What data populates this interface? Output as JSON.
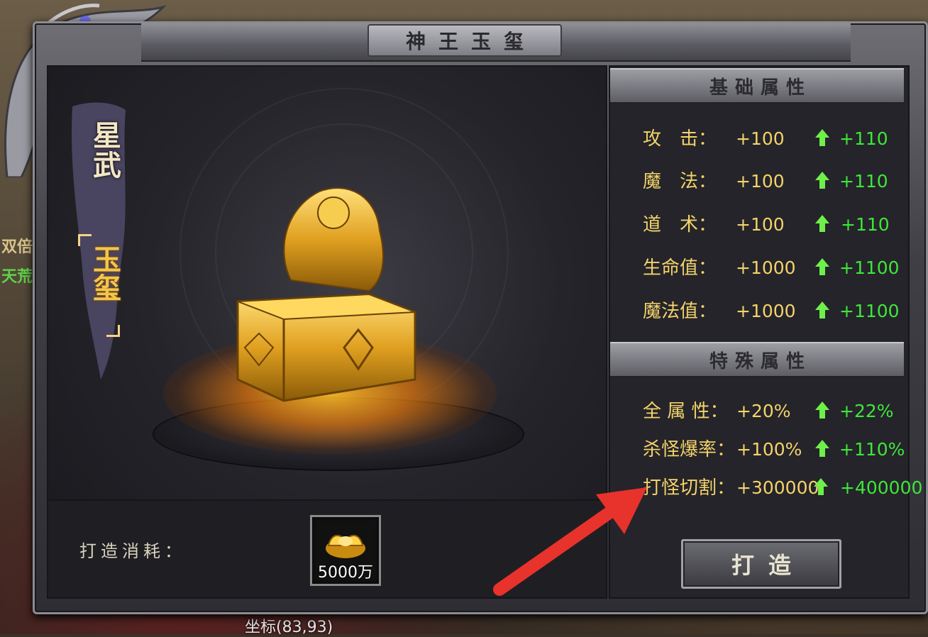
{
  "window": {
    "title": "神王玉玺"
  },
  "item": {
    "banner_line1": "星武",
    "banner_line2": "玉玺"
  },
  "cost": {
    "label": "打造消耗：",
    "amount": "5000万",
    "icon": "gold-ingot-icon"
  },
  "basic_attrs": {
    "title": "基础属性",
    "rows": [
      {
        "name": "攻　击：",
        "base": "+100",
        "new": "+110"
      },
      {
        "name": "魔　法：",
        "base": "+100",
        "new": "+110"
      },
      {
        "name": "道　术：",
        "base": "+100",
        "new": "+110"
      },
      {
        "name": "生命值：",
        "base": "+1000",
        "new": "+1100"
      },
      {
        "name": "魔法值：",
        "base": "+1000",
        "new": "+1100"
      }
    ]
  },
  "special_attrs": {
    "title": "特殊属性",
    "rows": [
      {
        "name": "全 属 性：",
        "base": "+20%",
        "new": "+22%"
      },
      {
        "name": "杀怪爆率：",
        "base": "+100%",
        "new": "+110%"
      },
      {
        "name": "打怪切割：",
        "base": "+300000",
        "new": "+400000"
      }
    ]
  },
  "forge_button": {
    "label": "打造"
  },
  "background": {
    "fragment1": "双倍",
    "fragment2": "天荒",
    "coords": "坐标(83,93)"
  },
  "colors": {
    "attr_text": "#f3d36a",
    "upgrade_text": "#3ee63a",
    "arrow": "#e8322c"
  }
}
